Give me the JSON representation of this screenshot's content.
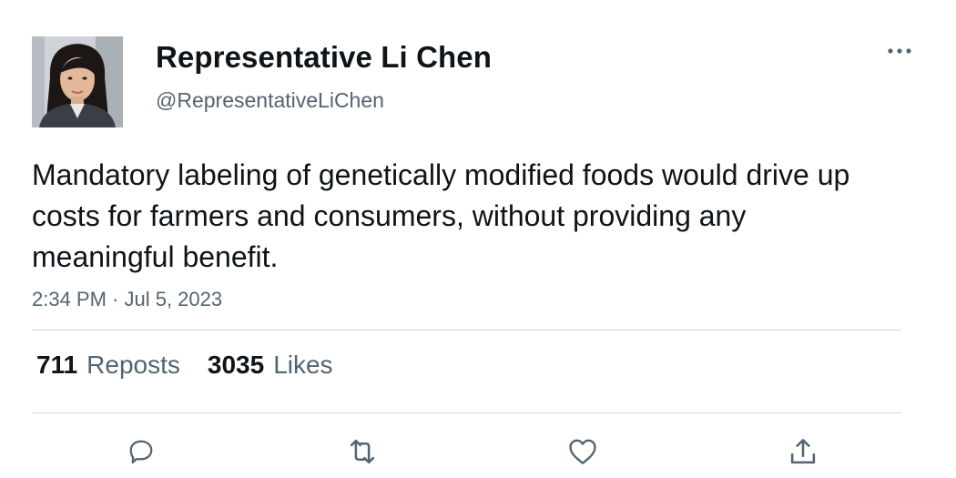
{
  "tweet": {
    "author_name": "Representative Li Chen",
    "author_handle": "@RepresentativeLiChen",
    "text": "Mandatory labeling of genetically modified foods would drive up costs for farmers and consumers, without providing any meaningful benefit.",
    "timestamp": "2:34 PM · Jul 5, 2023"
  },
  "stats": {
    "reposts_count": "711",
    "reposts_label": "Reposts",
    "likes_count": "3035",
    "likes_label": "Likes"
  },
  "icons": {
    "more": "more-horizontal-icon",
    "reply": "reply-icon",
    "repost": "repost-icon",
    "like": "heart-icon",
    "share": "share-icon"
  },
  "colors": {
    "text_primary": "#0f1419",
    "text_secondary": "#536471",
    "divider": "#cfd9de",
    "icon": "#536471"
  }
}
